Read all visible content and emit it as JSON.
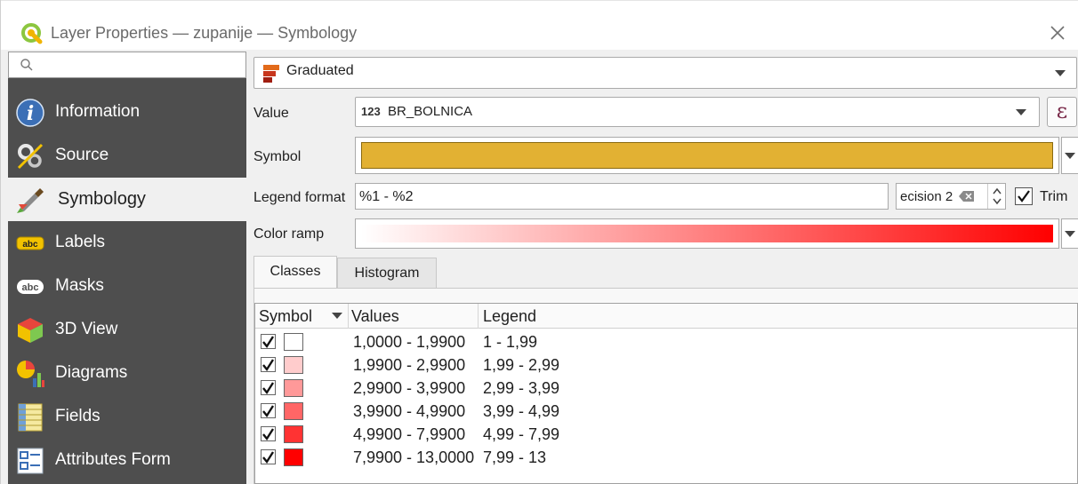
{
  "window": {
    "title": "Layer Properties — zupanije — Symbology"
  },
  "sidebar": {
    "search_placeholder": "",
    "items": [
      {
        "label": "Information",
        "icon": "information-icon"
      },
      {
        "label": "Source",
        "icon": "source-icon"
      },
      {
        "label": "Symbology",
        "icon": "symbology-icon",
        "active": true
      },
      {
        "label": "Labels",
        "icon": "labels-icon"
      },
      {
        "label": "Masks",
        "icon": "masks-icon"
      },
      {
        "label": "3D View",
        "icon": "3d-view-icon"
      },
      {
        "label": "Diagrams",
        "icon": "diagrams-icon"
      },
      {
        "label": "Fields",
        "icon": "fields-icon"
      },
      {
        "label": "Attributes Form",
        "icon": "attributes-form-icon"
      }
    ]
  },
  "renderer": {
    "type": "Graduated"
  },
  "form": {
    "value_label": "Value",
    "value_type_badge": "123",
    "value_field": "BR_BOLNICA",
    "expression_symbol": "ε",
    "symbol_label": "Symbol",
    "symbol_color": "#e2b133",
    "legend_format_label": "Legend format",
    "legend_format_value": "%1 - %2",
    "precision_text": "ecision 2",
    "trim_label": "Trim",
    "trim_checked": true,
    "color_ramp_label": "Color ramp",
    "ramp_start": "#ffffff",
    "ramp_end": "#ff0000"
  },
  "tabs": [
    {
      "label": "Classes",
      "active": true
    },
    {
      "label": "Histogram",
      "active": false
    }
  ],
  "classes_table": {
    "columns": [
      "Symbol",
      "Values",
      "Legend"
    ],
    "rows": [
      {
        "checked": true,
        "color": "#ffffff",
        "values": "1,0000 - 1,9900",
        "legend": "1 - 1,99"
      },
      {
        "checked": true,
        "color": "#ffcccc",
        "values": "1,9900 - 2,9900",
        "legend": "1,99 - 2,99"
      },
      {
        "checked": true,
        "color": "#ff9999",
        "values": "2,9900 - 3,9900",
        "legend": "2,99 - 3,99"
      },
      {
        "checked": true,
        "color": "#ff6666",
        "values": "3,9900 - 4,9900",
        "legend": "3,99 - 4,99"
      },
      {
        "checked": true,
        "color": "#ff3333",
        "values": "4,9900 - 7,9900",
        "legend": "4,99 - 7,99"
      },
      {
        "checked": true,
        "color": "#ff0000",
        "values": "7,9900 - 13,0000",
        "legend": "7,99 - 13"
      }
    ]
  }
}
